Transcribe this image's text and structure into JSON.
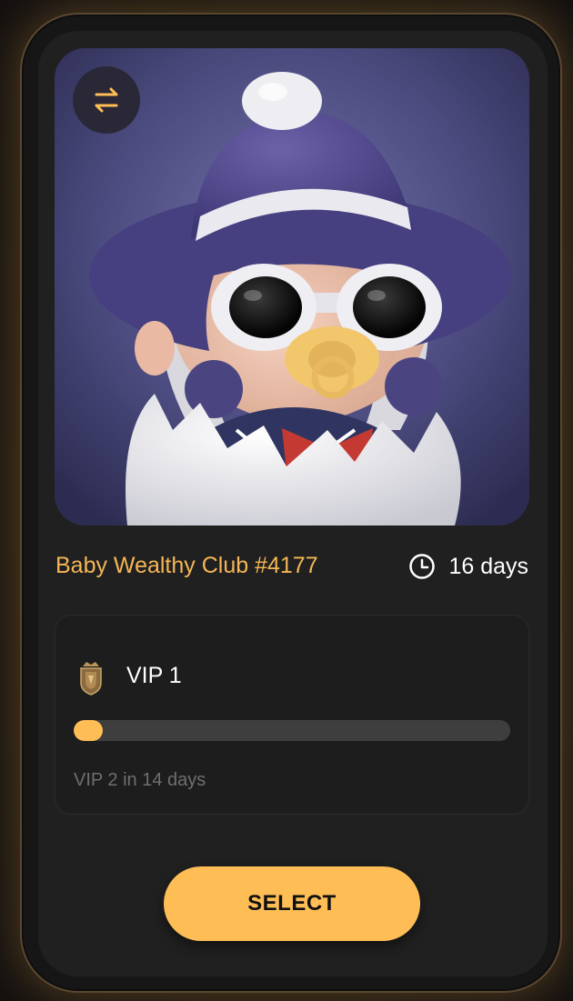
{
  "nft": {
    "name": "Baby Wealthy Club #4177",
    "duration": "16 days"
  },
  "vip": {
    "level_label": "VIP 1",
    "progress_fraction": 0.067,
    "next_label": "VIP 2 in 14 days"
  },
  "actions": {
    "select_label": "SELECT"
  },
  "icons": {
    "swap": "swap-arrows-icon",
    "timer": "clock-icon",
    "badge": "vip-shield-badge-icon"
  },
  "colors": {
    "accent": "#ffbe55",
    "name_text": "#f5b656",
    "card_bg": "#202020",
    "track": "#3e3e3e"
  }
}
